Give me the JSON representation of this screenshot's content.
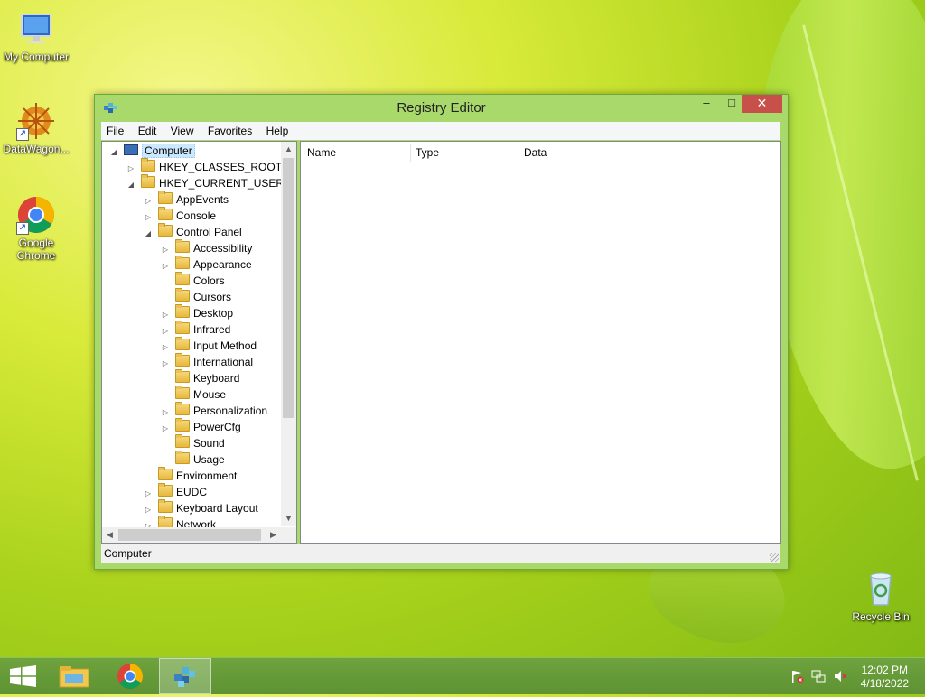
{
  "desktop": {
    "icons": [
      {
        "label": "My Computer"
      },
      {
        "label": "DataWagon..."
      },
      {
        "label": "Google Chrome"
      },
      {
        "label": "Recycle Bin"
      }
    ]
  },
  "window": {
    "title": "Registry Editor",
    "controls": {
      "minimize": "–",
      "maximize": "□",
      "close": "✕"
    },
    "menu": [
      "File",
      "Edit",
      "View",
      "Favorites",
      "Help"
    ],
    "tree": [
      {
        "label": "Computer",
        "expander": "◢",
        "selected": true
      },
      {
        "label": "HKEY_CLASSES_ROOT",
        "expander": "▷"
      },
      {
        "label": "HKEY_CURRENT_USER",
        "expander": "◢"
      },
      {
        "label": "AppEvents",
        "expander": "▷"
      },
      {
        "label": "Console",
        "expander": "▷"
      },
      {
        "label": "Control Panel",
        "expander": "◢"
      },
      {
        "label": "Accessibility",
        "expander": "▷"
      },
      {
        "label": "Appearance",
        "expander": "▷"
      },
      {
        "label": "Colors",
        "expander": ""
      },
      {
        "label": "Cursors",
        "expander": ""
      },
      {
        "label": "Desktop",
        "expander": "▷"
      },
      {
        "label": "Infrared",
        "expander": "▷"
      },
      {
        "label": "Input Method",
        "expander": "▷"
      },
      {
        "label": "International",
        "expander": "▷"
      },
      {
        "label": "Keyboard",
        "expander": ""
      },
      {
        "label": "Mouse",
        "expander": ""
      },
      {
        "label": "Personalization",
        "expander": "▷"
      },
      {
        "label": "PowerCfg",
        "expander": "▷"
      },
      {
        "label": "Sound",
        "expander": ""
      },
      {
        "label": "Usage",
        "expander": ""
      },
      {
        "label": "Environment",
        "expander": ""
      },
      {
        "label": "EUDC",
        "expander": "▷"
      },
      {
        "label": "Keyboard Layout",
        "expander": "▷"
      },
      {
        "label": "Network",
        "expander": "▷"
      }
    ],
    "list_columns": [
      "Name",
      "Type",
      "Data"
    ],
    "status": "Computer",
    "scroll": {
      "up": "▲",
      "down": "▼",
      "left": "◀",
      "right": "▶"
    }
  },
  "taskbar": {
    "clock_time": "12:02 PM",
    "clock_date": "4/18/2022"
  },
  "colors": {
    "accent": "#a9d86b",
    "taskbar": "#5e9233",
    "close": "#c7504a"
  }
}
